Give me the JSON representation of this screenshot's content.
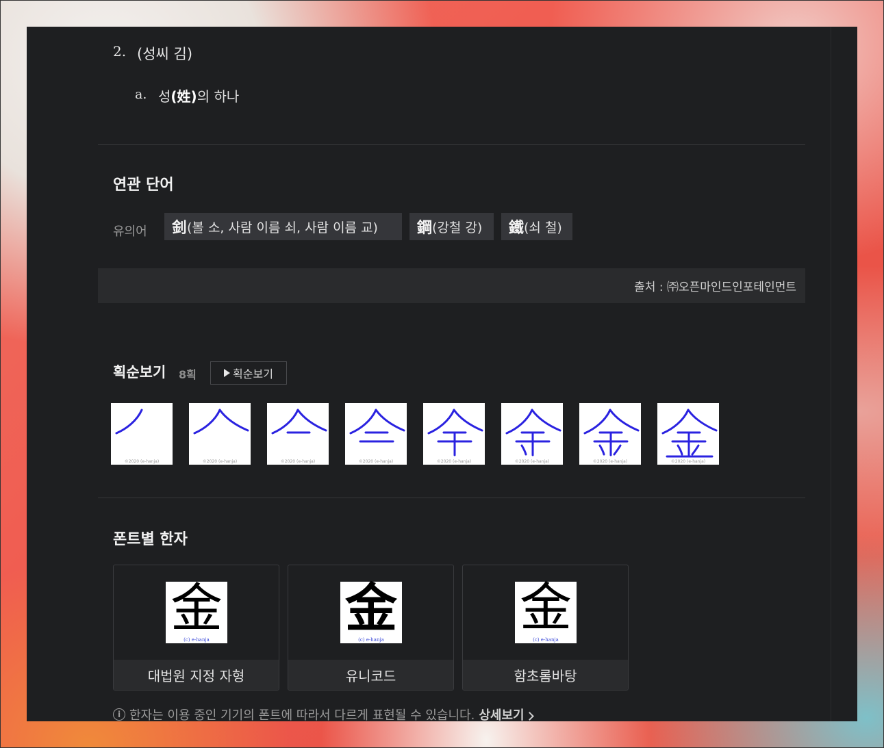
{
  "definition": {
    "number": "2.",
    "text": "(성씨 김)",
    "sub_number": "a.",
    "sub_prefix": "성",
    "sub_hanja": "(姓)",
    "sub_suffix": "의 하나"
  },
  "related": {
    "title": "연관 단어",
    "synonym_label": "유의어",
    "chips": [
      {
        "hanja": "釗",
        "reading": "(볼 소, 사람 이름 쇠, 사람 이름 교)"
      },
      {
        "hanja": "鋼",
        "reading": "(강철 강)"
      },
      {
        "hanja": "鐵",
        "reading": "(쇠 철)"
      }
    ]
  },
  "source": {
    "text": "출처 : ㈜오픈마인드인포테인먼트"
  },
  "stroke": {
    "title": "획순보기",
    "count": "8획",
    "button_label": "획순보기",
    "copyright": "©2020 (e-hanja)",
    "tiles": [
      1,
      2,
      3,
      4,
      5,
      6,
      7,
      8
    ],
    "color": "#2a22e0"
  },
  "fonts": {
    "title": "폰트별 한자",
    "character": "金",
    "watermark": "(c) e-hanja",
    "cards": [
      {
        "label": "대법원 지정 자형"
      },
      {
        "label": "유니코드"
      },
      {
        "label": "함초롬바탕"
      }
    ]
  },
  "note": {
    "icon": "info-icon",
    "text": "한자는 이용 중인 기기의 폰트에 따라서 다르게 표현될 수 있습니다.",
    "link": "상세보기"
  }
}
